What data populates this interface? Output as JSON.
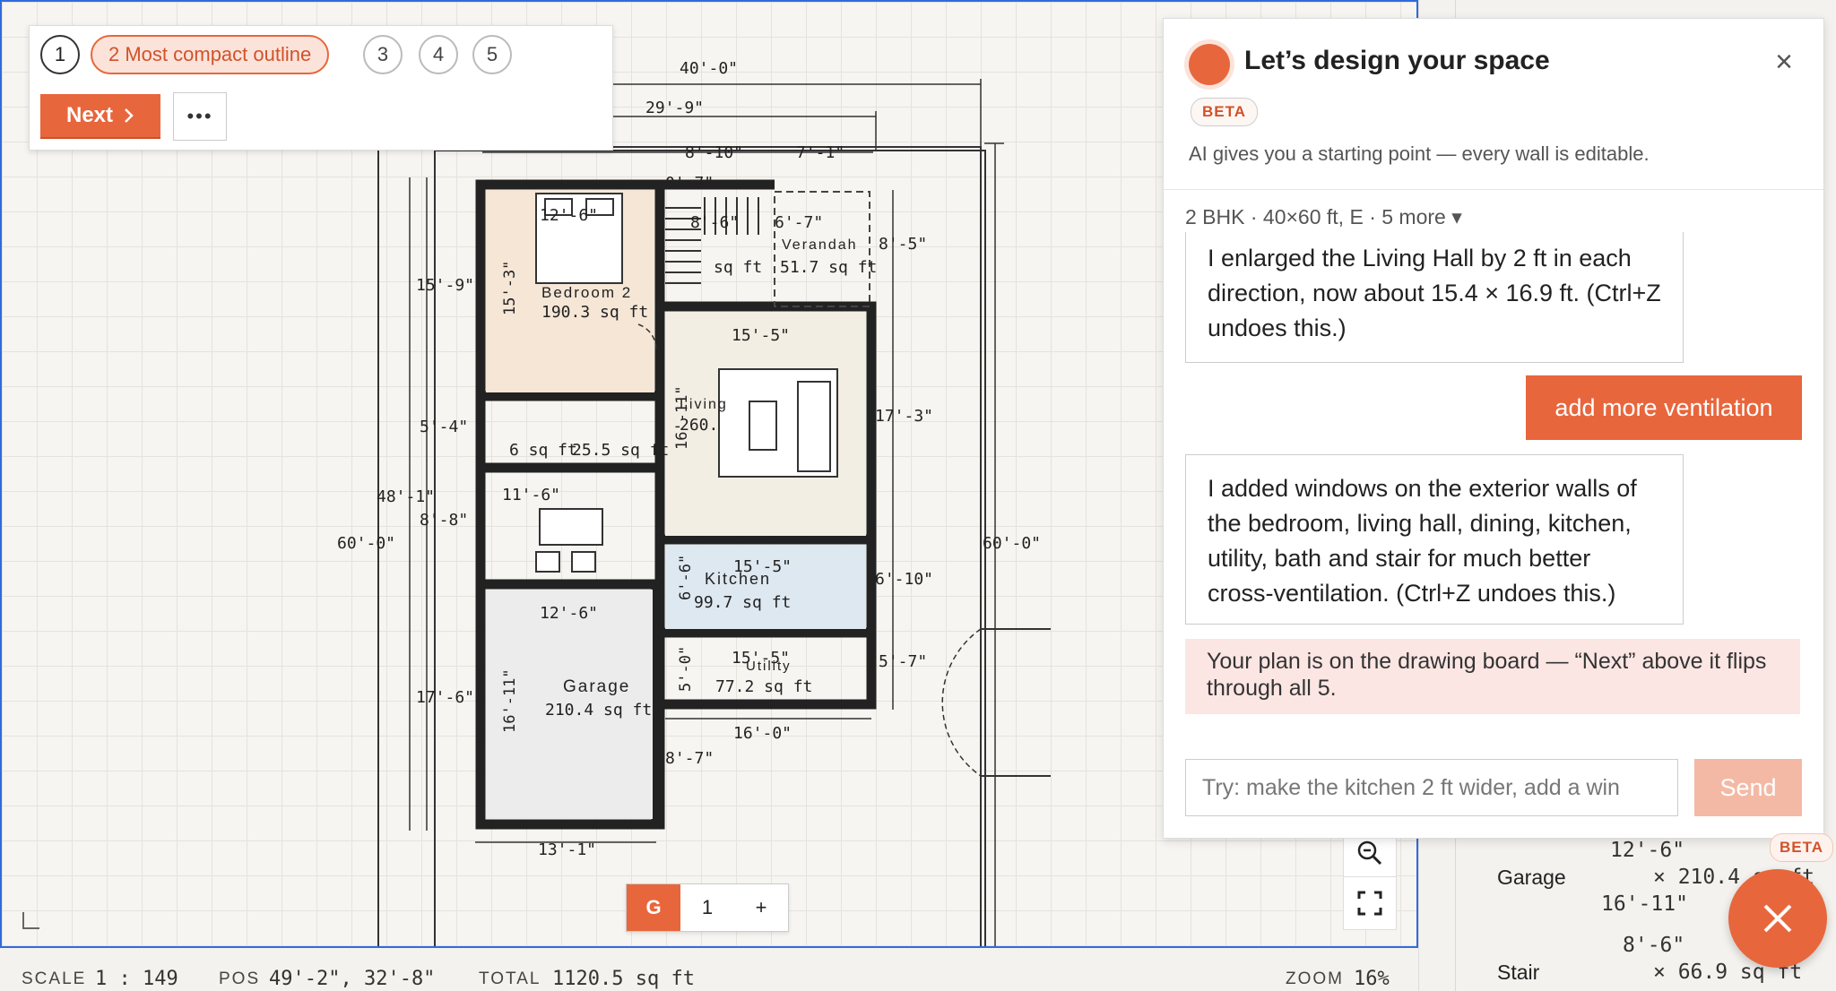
{
  "stepper": {
    "steps": [
      "1",
      "3",
      "4",
      "5"
    ],
    "selected_label": "2 Most compact outline",
    "next_label": "Next",
    "more_label": "•••"
  },
  "chat": {
    "title": "Let’s design your space",
    "beta": "BETA",
    "subtitle": "AI gives you a starting point — every wall is editable.",
    "meta": "2 BHK · 40×60 ft, E · 5 more ▾",
    "assistant_msg_1": "I enlarged the Living Hall by 2 ft in each direction, now about 15.4 × 16.9 ft. (Ctrl+Z undoes this.)",
    "user_msg": "add more ventilation",
    "assistant_msg_2": "I added windows on the exterior walls of the bedroom, living hall, dining, kitchen, utility, bath and stair for much better cross-ventilation. (Ctrl+Z undoes this.)",
    "notice": "Your plan is on the drawing board — “Next” above it flips through all 5.",
    "input_placeholder": "Try: make the kitchen 2 ft wider, add a win",
    "send_label": "Send",
    "close_icon": "×"
  },
  "plan": {
    "dims": {
      "top_outer": "40'-0\"",
      "top_mid": "29'-9\"",
      "top_a": "8'-10\"",
      "top_b": "7'-1\"",
      "left_total": "60'-0\"",
      "right_total": "60'-0\"",
      "left_a": "15'-9\"",
      "left_b": "5'-4\"",
      "left_c": "48'-1\"",
      "left_d": "8'-8\"",
      "left_e": "17'-6\"",
      "right_a": "8'-5\"",
      "right_b": "17'-3\"",
      "right_c": "6'-10\"",
      "right_d": "5'-7\"",
      "bottom_a": "13'-1\"",
      "bottom_b": "16'-0\"",
      "garage_side": "8'-7\"",
      "stair_top": "0'-7\""
    },
    "rooms": {
      "bedroom_name": "Bedroom 2",
      "bedroom_area": "190.3 sq ft",
      "bedroom_w": "12'-6\"",
      "bedroom_h": "15'-3\"",
      "verandah_name": "Verandah",
      "verandah_area": "51.7 sq ft",
      "stair_area": "sq ft",
      "stair_w": "8'-6\"",
      "verandah_w": "6'-7\"",
      "living_name": "Living",
      "living_area": "260.",
      "living_w": "15'-5\"",
      "living_h": "16'-11\"",
      "bath_area": "6 sq ft",
      "pooja_area": "25.5 sq ft",
      "dining_w": "11'-6\"",
      "kitchen_name": "Kitchen",
      "kitchen_area": "99.7 sq ft",
      "kitchen_w": "15'-5\"",
      "kitchen_h": "6'-6\"",
      "utility_name": "Utility",
      "utility_area": "77.2 sq ft",
      "utility_w": "15'-5\"",
      "utility_h": "5'-0\"",
      "garage_name": "Garage",
      "garage_area": "210.4 sq ft",
      "garage_w": "12'-6\"",
      "garage_h": "16'-11\""
    }
  },
  "floor_tabs": [
    "G",
    "1",
    "+"
  ],
  "status": {
    "scale_label": "SCALE",
    "scale_value": "1 : 149",
    "pos_label": "POS",
    "pos_value": "49'-2\", 32'-8\"",
    "total_label": "TOTAL",
    "total_value": "1120.5 sq ft",
    "zoom_label": "ZOOM",
    "zoom_value": "16%"
  },
  "room_list": [
    {
      "name": "Garage",
      "dim_a": "12'-6\"",
      "area": "× 210.4 sq ft",
      "dim_b": "16'-11\""
    },
    {
      "name": "Stair",
      "dim_a": "8'-6\"",
      "area": "× 66.9 sq ft",
      "dim_b": ""
    }
  ],
  "fab": {
    "beta": "BETA",
    "icon": "close-icon"
  },
  "colors": {
    "accent": "#e8663c",
    "selection": "#2f6be0"
  }
}
